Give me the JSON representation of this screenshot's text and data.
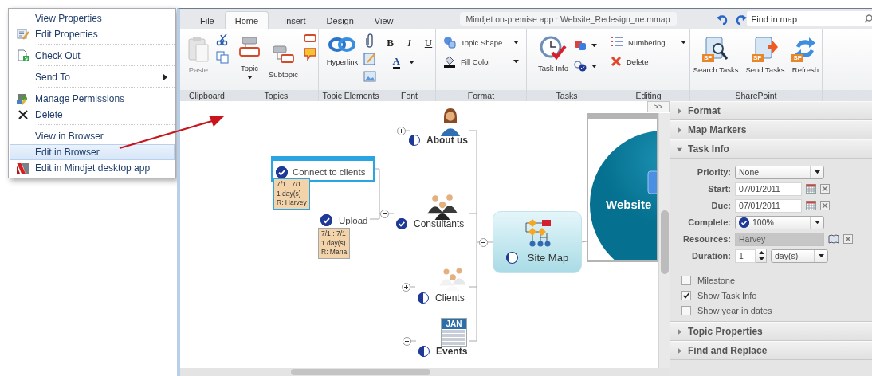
{
  "context_menu": {
    "groups": [
      [
        {
          "label": "View Properties",
          "selected": false,
          "submenu": false
        },
        {
          "label": "Edit Properties",
          "selected": false,
          "submenu": false
        }
      ],
      [
        {
          "label": "Check Out",
          "selected": false,
          "submenu": false
        }
      ],
      [
        {
          "label": "Send To",
          "selected": false,
          "submenu": true
        }
      ],
      [
        {
          "label": "Manage Permissions",
          "selected": false,
          "submenu": false
        },
        {
          "label": "Delete",
          "selected": false,
          "submenu": false
        }
      ],
      [
        {
          "label": "View in Browser",
          "selected": false,
          "submenu": false
        },
        {
          "label": "Edit in Browser",
          "selected": true,
          "submenu": false
        },
        {
          "label": "Edit in Mindjet desktop app",
          "selected": false,
          "submenu": false
        }
      ]
    ]
  },
  "app": {
    "tabs": [
      {
        "label": "File",
        "selected": false
      },
      {
        "label": "Home",
        "selected": true
      },
      {
        "label": "Insert",
        "selected": false
      },
      {
        "label": "Design",
        "selected": false
      },
      {
        "label": "View",
        "selected": false
      }
    ],
    "document_title": "Mindjet on-premise app : Website_Redesign_ne.mmap",
    "search": {
      "placeholder": "Find in map"
    },
    "ribbon": [
      {
        "label": "Clipboard",
        "commands": [
          {
            "label": "Paste",
            "kind": "large",
            "disabled": true,
            "dropdown": false
          }
        ]
      },
      {
        "label": "Topics",
        "commands": [
          {
            "label": "Topic",
            "kind": "large",
            "disabled": false,
            "dropdown": true
          },
          {
            "label": "Subtopic",
            "kind": "large",
            "disabled": false,
            "dropdown": false
          }
        ]
      },
      {
        "label": "Topic Elements",
        "commands": [
          {
            "label": "Hyperlink",
            "kind": "large",
            "disabled": false,
            "dropdown": false
          }
        ]
      },
      {
        "label": "Font",
        "commands": [
          {
            "label": "B",
            "kind": "char",
            "disabled": false,
            "dropdown": false
          },
          {
            "label": "I",
            "kind": "char",
            "disabled": false,
            "dropdown": false
          },
          {
            "label": "U",
            "kind": "char",
            "disabled": false,
            "dropdown": false
          },
          {
            "label": "A",
            "kind": "char",
            "disabled": false,
            "dropdown": true
          }
        ]
      },
      {
        "label": "Format",
        "commands": [
          {
            "label": "Topic Shape",
            "kind": "small",
            "disabled": false,
            "dropdown": true
          },
          {
            "label": "Fill Color",
            "kind": "small",
            "disabled": false,
            "dropdown": true
          }
        ]
      },
      {
        "label": "Tasks",
        "commands": [
          {
            "label": "Task Info",
            "kind": "large",
            "disabled": false,
            "dropdown": false
          }
        ]
      },
      {
        "label": "Editing",
        "commands": [
          {
            "label": "Numbering",
            "kind": "small",
            "disabled": false,
            "dropdown": true
          },
          {
            "label": "Delete",
            "kind": "small",
            "disabled": false,
            "dropdown": false
          }
        ]
      },
      {
        "label": "SharePoint",
        "commands": [
          {
            "label": "Search Tasks",
            "kind": "large",
            "disabled": false,
            "dropdown": false,
            "badge": "SP"
          },
          {
            "label": "Send Tasks",
            "kind": "large",
            "disabled": false,
            "dropdown": false,
            "badge": "SP"
          },
          {
            "label": "Refresh",
            "kind": "large",
            "disabled": false,
            "dropdown": false,
            "badge": "SP"
          }
        ]
      }
    ],
    "map": {
      "central": {
        "label": "Website"
      },
      "topic": {
        "label": "Site Map",
        "level": 0.25,
        "expanded": true,
        "children": [
          {
            "label": "About us",
            "level": 0.5,
            "bold": true,
            "expanded": false,
            "selected": false
          },
          {
            "label": "Consultants",
            "level": 1,
            "bold": false,
            "expanded": true,
            "selected": false,
            "children": [
              {
                "label": "Connect to clients",
                "level": 1,
                "selected": true,
                "task_info": [
                  "7/1 : 7/1",
                  "1 day(s)",
                  "R: Harvey"
                ]
              },
              {
                "label": "Upload",
                "level": 1,
                "selected": false,
                "task_info": [
                  "7/1 : 7/1",
                  "1 day(s)",
                  "R: Maria"
                ]
              }
            ]
          },
          {
            "label": "Clients",
            "level": 0.5,
            "bold": false,
            "expanded": false,
            "selected": false
          },
          {
            "label": "Events",
            "level": 0.5,
            "bold": true,
            "expanded": false,
            "selected": false,
            "icon_text": "JAN"
          }
        ]
      }
    },
    "panel": {
      "toggle": ">>",
      "sections": [
        {
          "title": "Format",
          "expanded": false
        },
        {
          "title": "Map Markers",
          "expanded": false
        },
        {
          "title": "Task Info",
          "expanded": true,
          "fields": [
            {
              "label": "Priority:",
              "kind": "select",
              "value": "None"
            },
            {
              "label": "Start:",
              "kind": "date",
              "value": "07/01/2011"
            },
            {
              "label": "Due:",
              "kind": "date",
              "value": "07/01/2011"
            },
            {
              "label": "Complete:",
              "kind": "complete",
              "value": "100%",
              "level": 1
            },
            {
              "label": "Resources:",
              "kind": "resource",
              "value": "Harvey"
            },
            {
              "label": "Duration:",
              "kind": "duration",
              "value": "1",
              "unit": "day(s)"
            }
          ],
          "options": [
            {
              "label": "Milestone",
              "checked": false
            },
            {
              "label": "Show Task Info",
              "checked": true
            },
            {
              "label": "Show year in dates",
              "checked": false
            }
          ]
        },
        {
          "title": "Topic Properties",
          "expanded": false
        },
        {
          "title": "Find and Replace",
          "expanded": false
        }
      ]
    }
  }
}
